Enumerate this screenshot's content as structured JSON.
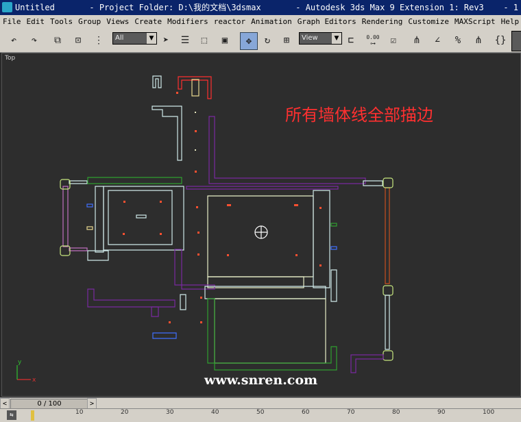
{
  "window": {
    "title_left": "Untitled",
    "title_mid": "- Project Folder: D:\\我的文档\\3dsmax",
    "title_right": "- Autodesk 3ds Max 9 Extension 1: Rev3",
    "title_tail": "- 1"
  },
  "menu": [
    "File",
    "Edit",
    "Tools",
    "Group",
    "Views",
    "Create",
    "Modifiers",
    "reactor",
    "Animation",
    "Graph Editors",
    "Rendering",
    "Customize",
    "MAXScript",
    "Help"
  ],
  "toolbar": {
    "selection_filter": "All",
    "ref_coord": "View",
    "snap_value": "0.00"
  },
  "viewport": {
    "label": "Top",
    "annotation": "所有墙体线全部描边",
    "watermark": "www.snren.com",
    "axis_y": "y",
    "axis_x": "x"
  },
  "timeline": {
    "frame_display": "0 / 100",
    "prev_label": "<",
    "next_label": ">",
    "ticks": [
      "10",
      "20",
      "30",
      "40",
      "50",
      "60",
      "70",
      "80",
      "90",
      "100"
    ]
  },
  "colors": {
    "title_bg": "#0a246a",
    "ui_gray": "#d4d0c8",
    "viewport_bg": "#2d2d2d",
    "annotation": "#ff3030"
  }
}
